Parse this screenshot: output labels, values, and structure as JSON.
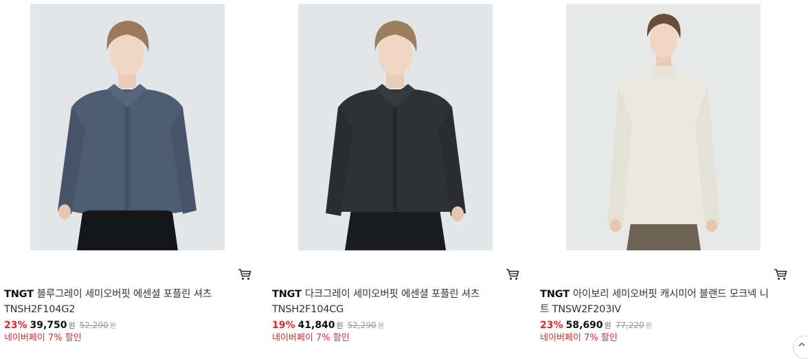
{
  "products": [
    {
      "brand": "TNGT",
      "name": "블루그레이 세미오버핏 에센셜 포플린 셔츠 TNSH2F104G2",
      "discount": "23%",
      "price": "39,750",
      "currency": "원",
      "original_price": "52,290",
      "promo": "네이버페이 7% 할인",
      "image_icon": "model-shirt-bluegray",
      "colors": {
        "garment": "#4e5c72",
        "background": "#e3e6e8"
      }
    },
    {
      "brand": "TNGT",
      "name": "다크그레이 세미오버핏 에센셜 포플린 셔츠 TNSH2F104CG",
      "discount": "19%",
      "price": "41,840",
      "currency": "원",
      "original_price": "52,290",
      "promo": "네이버페이 7% 할인",
      "image_icon": "model-shirt-darkgray",
      "colors": {
        "garment": "#2f3136",
        "background": "#e3e6e8"
      }
    },
    {
      "brand": "TNGT",
      "name": "아이보리 세미오버핏 캐시미어 블랜드 모크넥 니트 TNSW2F203IV",
      "discount": "23%",
      "price": "58,690",
      "currency": "원",
      "original_price": "77,220",
      "promo": "네이버페이 7% 할인",
      "image_icon": "model-knit-ivory",
      "colors": {
        "garment": "#ebe8df",
        "background": "#e7e8e8"
      }
    }
  ],
  "icons": {
    "cart": "cart-icon",
    "scroll_top": "arrow-up-icon"
  },
  "theme": {
    "discount_color": "#e52528",
    "text_color": "#333333"
  }
}
